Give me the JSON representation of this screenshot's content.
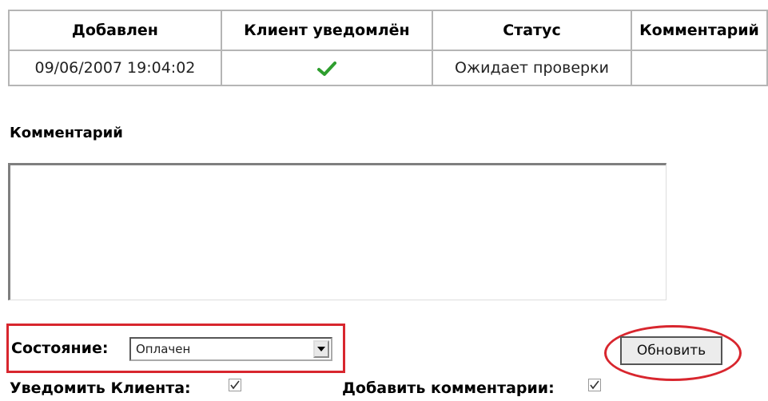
{
  "history_table": {
    "headers": [
      "Добавлен",
      "Клиент уведомлён",
      "Статус",
      "Комментарий"
    ],
    "rows": [
      {
        "added": "09/06/2007 19:04:02",
        "client_notified_icon": "check-icon",
        "status": "Ожидает проверки",
        "comment": ""
      }
    ]
  },
  "comment_section": {
    "heading": "Комментарий",
    "value": ""
  },
  "status_control": {
    "label": "Состояние:",
    "selected": "Оплачен"
  },
  "update_button": {
    "label": "Обновить"
  },
  "options": {
    "notify_label": "Уведомить Клиента:",
    "notify_checked": true,
    "add_comment_label": "Добавить комментарии:",
    "add_comment_checked": true
  },
  "colors": {
    "highlight_red": "#d8262e",
    "check_green": "#2e9e2e",
    "border_gray": "#b5b5b5"
  }
}
